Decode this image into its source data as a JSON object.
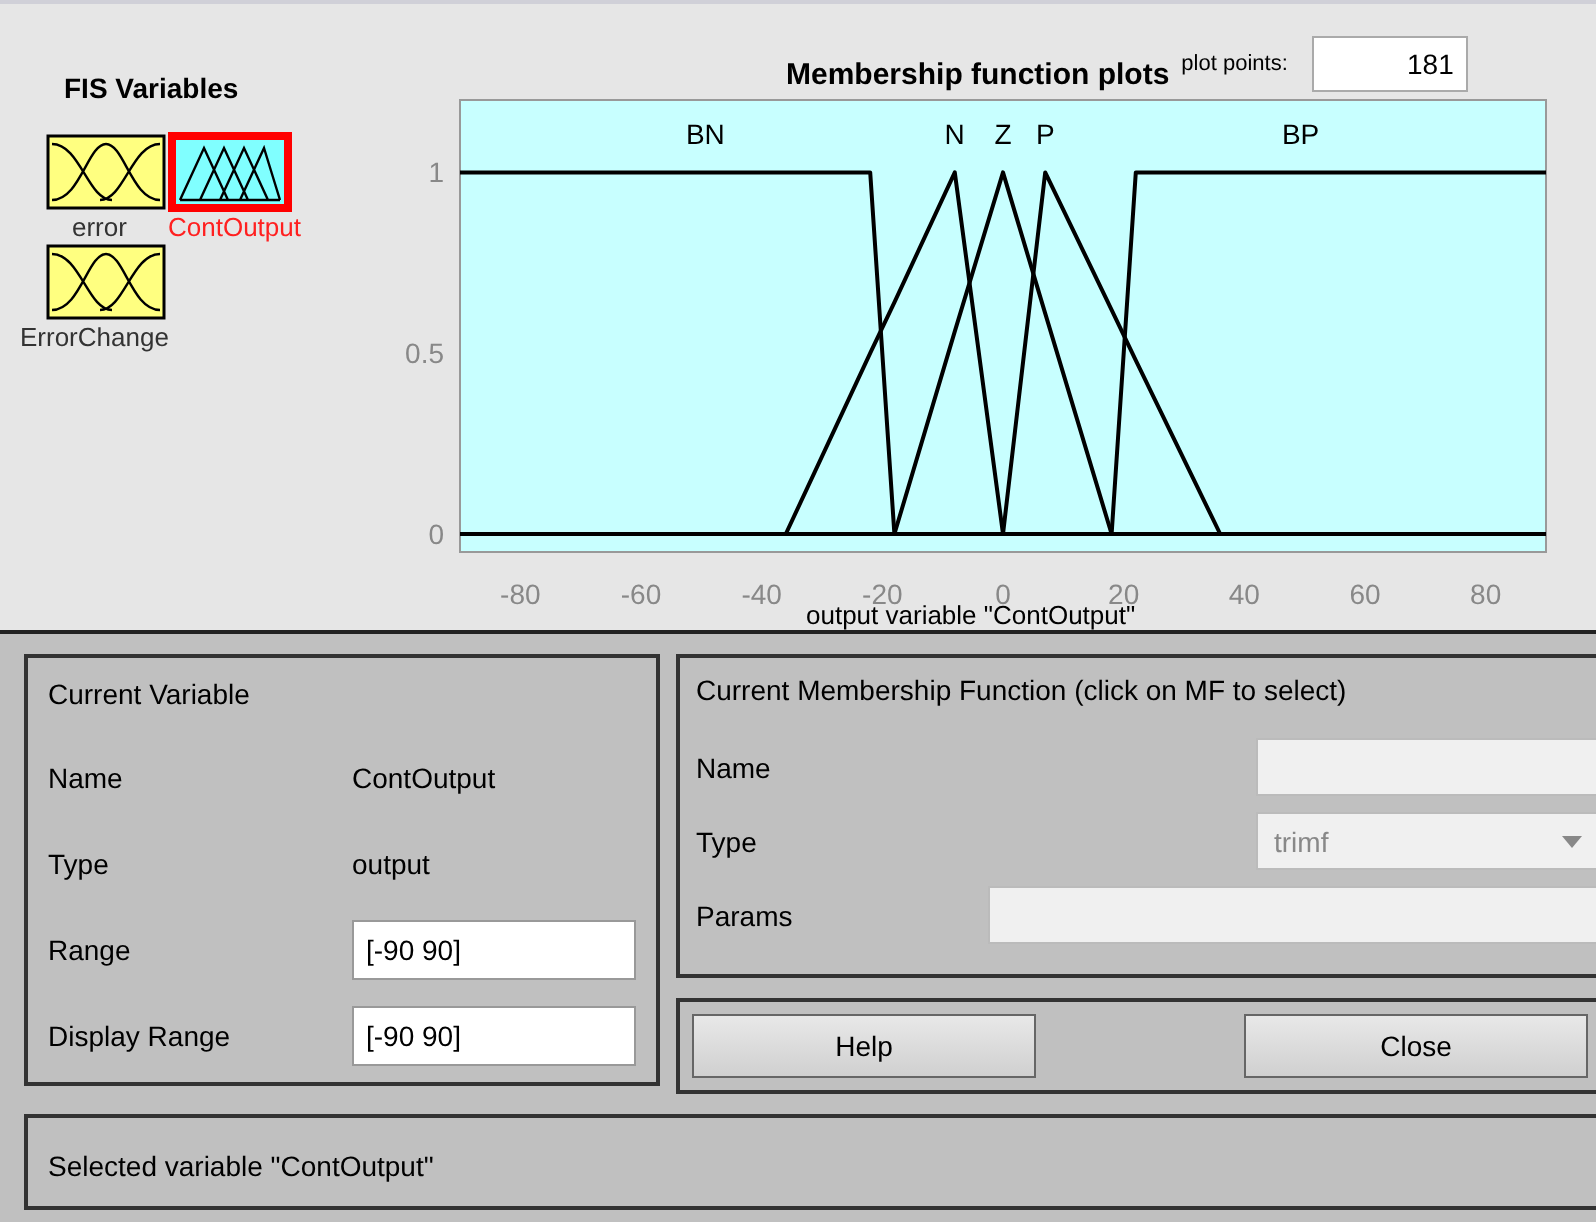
{
  "fis_variables": {
    "title": "FIS Variables",
    "items": [
      {
        "name": "error",
        "kind": "input",
        "selected": false
      },
      {
        "name": "ContOutput",
        "kind": "output",
        "selected": true
      },
      {
        "name": "ErrorChange",
        "kind": "input",
        "selected": false
      }
    ]
  },
  "plot": {
    "title": "Membership function plots",
    "plot_points_label": "plot points:",
    "plot_points": "181",
    "chart_data": {
      "type": "line",
      "xlabel": "output variable \"ContOutput\"",
      "x": [
        -90,
        -36,
        -22,
        -18,
        -8,
        0,
        7,
        18,
        22,
        36,
        90
      ],
      "series": [
        {
          "name": "BN",
          "color": "#000000",
          "values": [
            1,
            1,
            1,
            0,
            null,
            null,
            null,
            null,
            null,
            null,
            null
          ]
        },
        {
          "name": "N",
          "color": "#000000",
          "values": [
            null,
            0,
            0.5,
            0.64,
            1,
            0,
            null,
            null,
            null,
            null,
            null
          ]
        },
        {
          "name": "Z",
          "color": "#000000",
          "values": [
            null,
            null,
            null,
            0,
            0.56,
            1,
            0.61,
            0,
            null,
            null,
            null
          ]
        },
        {
          "name": "P",
          "color": "#000000",
          "values": [
            null,
            null,
            null,
            null,
            null,
            0,
            1,
            0.62,
            0.48,
            0,
            null
          ]
        },
        {
          "name": "BP",
          "color": "#000000",
          "values": [
            null,
            null,
            null,
            null,
            null,
            null,
            null,
            0,
            1,
            1,
            1
          ]
        }
      ],
      "xlim": [
        -90,
        90
      ],
      "ylim": [
        -0.05,
        1.2
      ],
      "xticks": [
        -80,
        -60,
        -40,
        -20,
        0,
        20,
        40,
        60,
        80
      ],
      "yticks": [
        0,
        0.5,
        1
      ]
    }
  },
  "current_variable": {
    "title": "Current Variable",
    "rows": [
      {
        "label": "Name",
        "kind": "text",
        "value": "ContOutput"
      },
      {
        "label": "Type",
        "kind": "text",
        "value": "output"
      },
      {
        "label": "Range",
        "kind": "field",
        "value": "[-90 90]"
      },
      {
        "label": "Display Range",
        "kind": "field",
        "value": "[-90 90]"
      }
    ]
  },
  "current_mf": {
    "title": "Current Membership Function (click on MF to select)",
    "rows": [
      {
        "label": "Name",
        "kind": "field",
        "disabled": true
      },
      {
        "label": "Type",
        "kind": "dropdown",
        "value": "trimf",
        "disabled": true
      },
      {
        "label": "Params",
        "kind": "wide_field",
        "disabled": true
      }
    ]
  },
  "buttons": [
    "Help",
    "Close"
  ],
  "status": "Selected variable \"ContOutput\""
}
